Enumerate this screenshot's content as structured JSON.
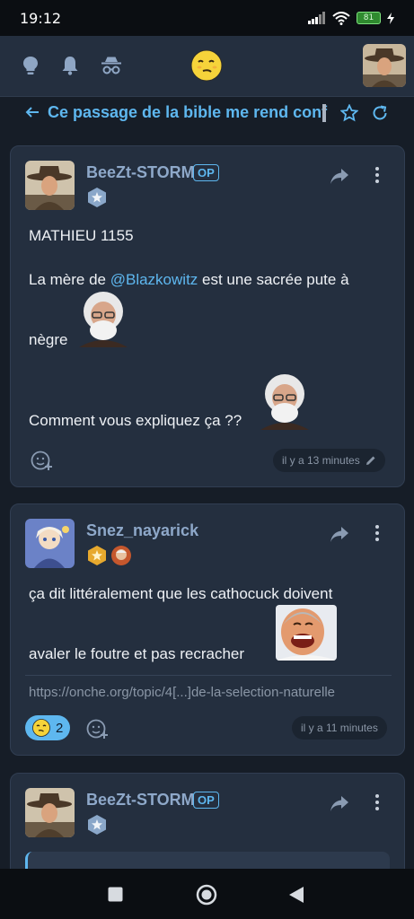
{
  "status": {
    "time": "19:12",
    "battery": "81"
  },
  "header": {
    "icons": [
      "lightbulb-icon",
      "bell-icon",
      "incognito-icon"
    ],
    "logo": "smiley-logo-icon"
  },
  "topic": {
    "title": "Ce passage de la bible me rend confus"
  },
  "posts": [
    {
      "username": "BeeZt-STORM",
      "op": "OP",
      "lines": [
        "MATHIEU 1155",
        "La mère de ",
        "@Blazkowitz",
        " est une sacrée pute à",
        "nègre",
        "Comment vous expliquez ça ??"
      ],
      "time": "il y a 13 minutes"
    },
    {
      "username": "Snez_nayarick",
      "lines": [
        "ça dit littéralement que les cathocuck doivent",
        "avaler le foutre et pas recracher"
      ],
      "link": "https://onche.org/topic/4[...]de-la-selection-naturelle",
      "reaction_count": "2",
      "time": "il y a 11 minutes"
    },
    {
      "username": "BeeZt-STORM",
      "op": "OP"
    }
  ],
  "colors": {
    "accent": "#5eb7ef",
    "card": "#242f3f",
    "background": "#161d27"
  }
}
